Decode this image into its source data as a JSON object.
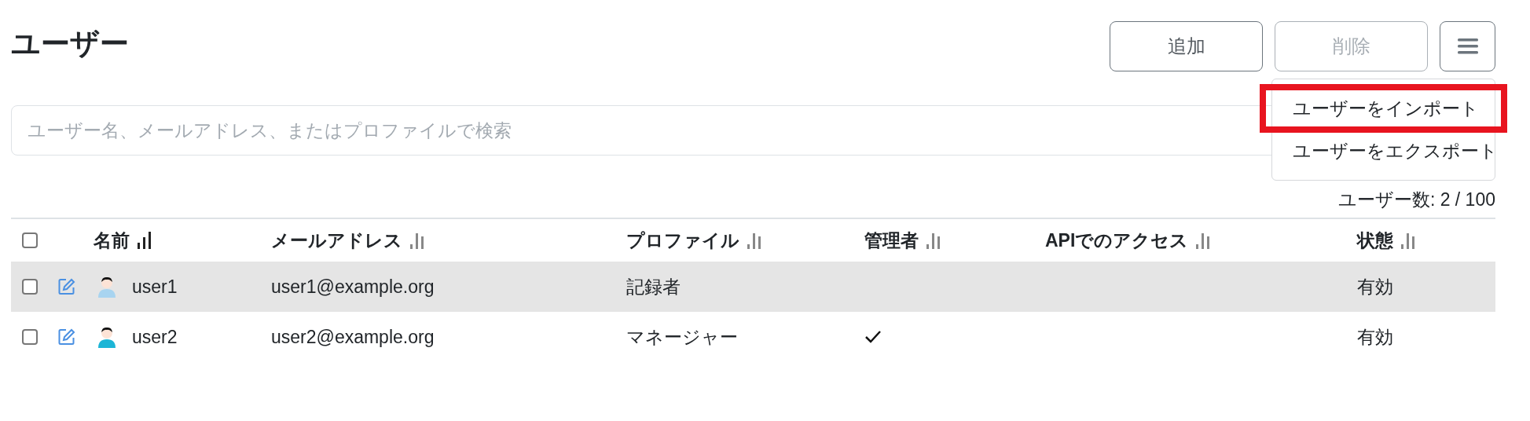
{
  "title": "ユーザー",
  "buttons": [
    {
      "label": "追加",
      "disabled": false
    },
    {
      "label": "削除",
      "disabled": true
    }
  ],
  "menu": {
    "expanded": true,
    "items": [
      {
        "label": "ユーザーをインポート",
        "highlighted": true
      },
      {
        "label": "ユーザーをエクスポート",
        "highlighted": false
      }
    ]
  },
  "search": {
    "placeholder": "ユーザー名、メールアドレス、またはプロファイルで検索"
  },
  "user_count": "ユーザー数: 2 / 100",
  "table": {
    "select_all": {
      "checked": false
    },
    "columns": [
      {
        "label": "名前",
        "sorted": true
      },
      {
        "label": "メールアドレス",
        "sorted": false
      },
      {
        "label": "プロファイル",
        "sorted": false
      },
      {
        "label": "管理者",
        "sorted": false
      },
      {
        "label": "APIでのアクセス",
        "sorted": false
      },
      {
        "label": "状態",
        "sorted": false
      }
    ],
    "rows": [
      {
        "checked": false,
        "highlighted": true,
        "color": "#a8d4f0",
        "name": "user1",
        "email": "user1@example.org",
        "profile": "記録者",
        "admin": false,
        "status": "有効"
      },
      {
        "checked": false,
        "highlighted": false,
        "color": "#1cb5d6",
        "name": "user2",
        "email": "user2@example.org",
        "profile": "マネージャー",
        "admin": true,
        "status": "有効"
      }
    ]
  }
}
